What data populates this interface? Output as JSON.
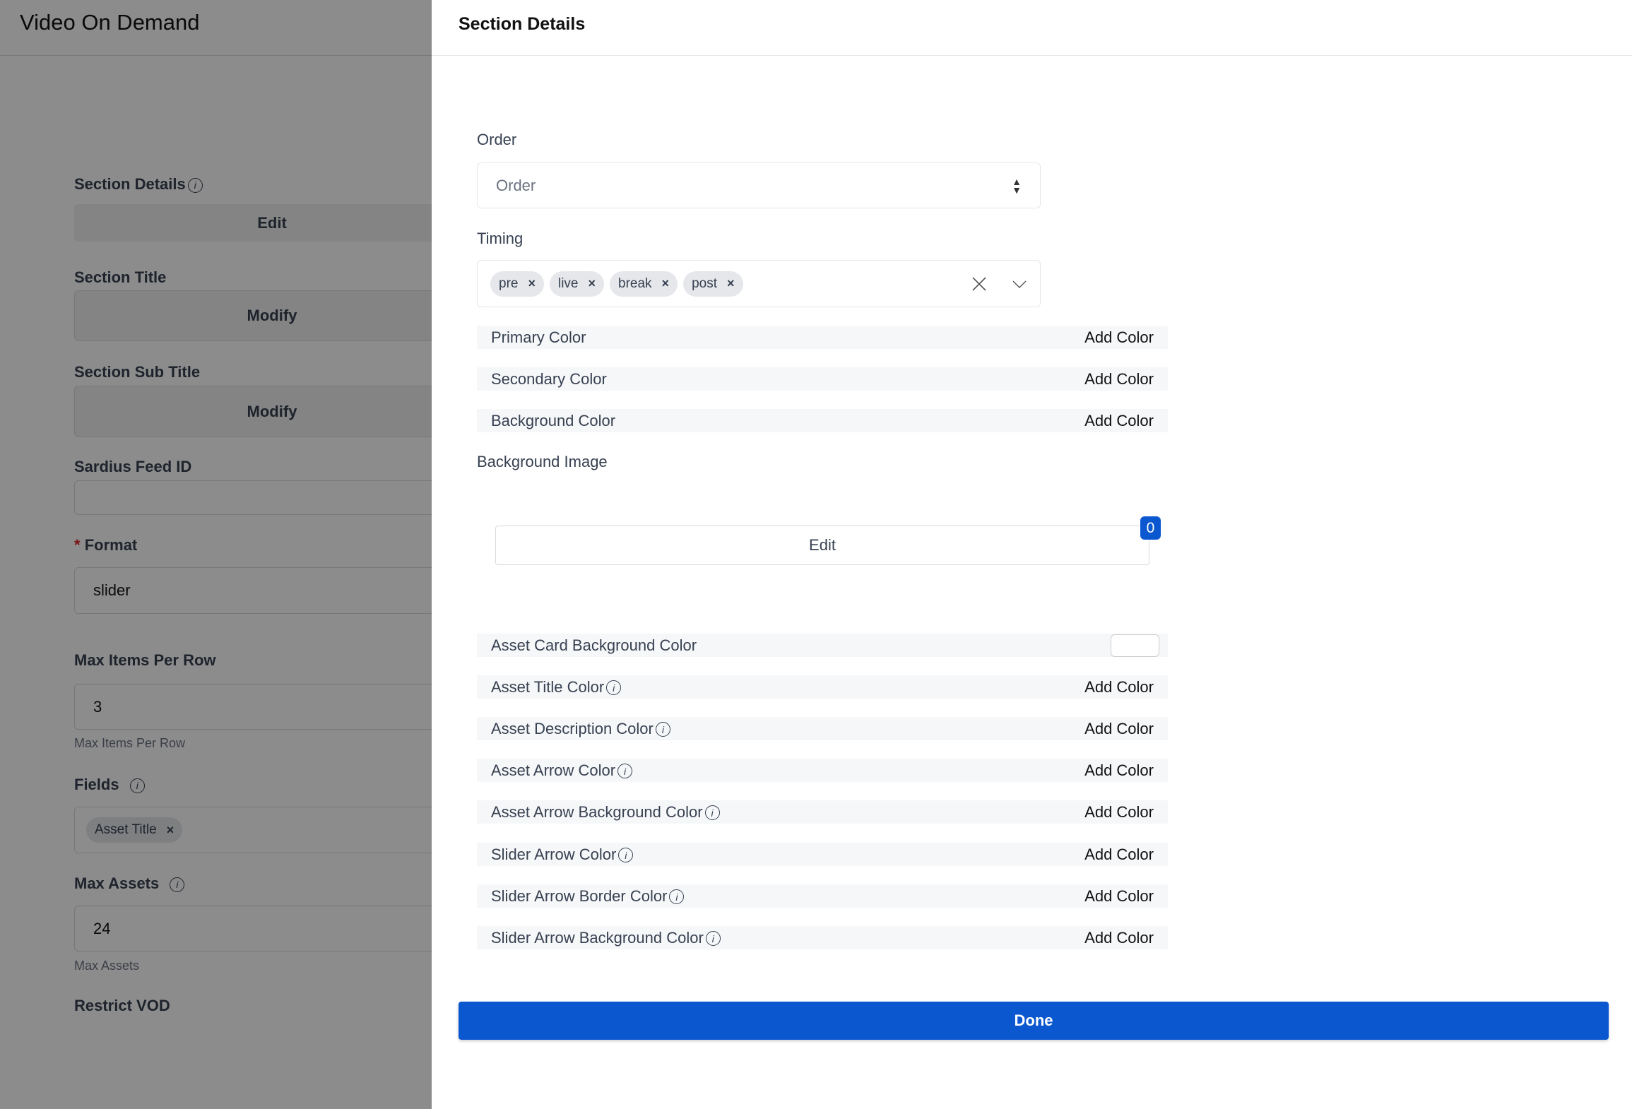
{
  "page": {
    "title": "Video On Demand",
    "section_details": {
      "label": "Section Details",
      "button": "Edit"
    },
    "section_title": {
      "label": "Section Title",
      "button": "Modify"
    },
    "section_sub_title": {
      "label": "Section Sub Title",
      "button": "Modify"
    },
    "sardius_feed_id": {
      "label": "Sardius Feed ID",
      "value": ""
    },
    "format": {
      "required": "*",
      "label": "Format",
      "value": "slider"
    },
    "max_items_per_row": {
      "label": "Max Items Per Row",
      "value": "3",
      "help": "Max Items Per Row"
    },
    "fields": {
      "label": "Fields",
      "tags": [
        "Asset Title"
      ]
    },
    "max_assets": {
      "label": "Max Assets",
      "value": "24",
      "help": "Max Assets"
    },
    "restrict_vod": {
      "label": "Restrict VOD"
    }
  },
  "drawer": {
    "title": "Section Details",
    "order": {
      "label": "Order",
      "placeholder": "Order"
    },
    "timing": {
      "label": "Timing",
      "tags": [
        "pre",
        "live",
        "break",
        "post"
      ]
    },
    "colors_top": [
      {
        "name": "Primary Color",
        "action": "Add Color"
      },
      {
        "name": "Secondary Color",
        "action": "Add Color"
      },
      {
        "name": "Background Color",
        "action": "Add Color"
      }
    ],
    "background_image": {
      "label": "Background Image",
      "button": "Edit",
      "badge": "0"
    },
    "asset_card_bg": {
      "name": "Asset Card Background Color",
      "swatch": "#ffffff"
    },
    "colors_bottom": [
      {
        "name": "Asset Title Color",
        "action": "Add Color"
      },
      {
        "name": "Asset Description Color",
        "action": "Add Color"
      },
      {
        "name": "Asset Arrow Color",
        "action": "Add Color"
      },
      {
        "name": "Asset Arrow Background Color",
        "action": "Add Color"
      },
      {
        "name": "Slider Arrow Color",
        "action": "Add Color"
      },
      {
        "name": "Slider Arrow Border Color",
        "action": "Add Color"
      },
      {
        "name": "Slider Arrow Background Color",
        "action": "Add Color"
      }
    ],
    "done": "Done",
    "accent": "#0b57d0"
  }
}
